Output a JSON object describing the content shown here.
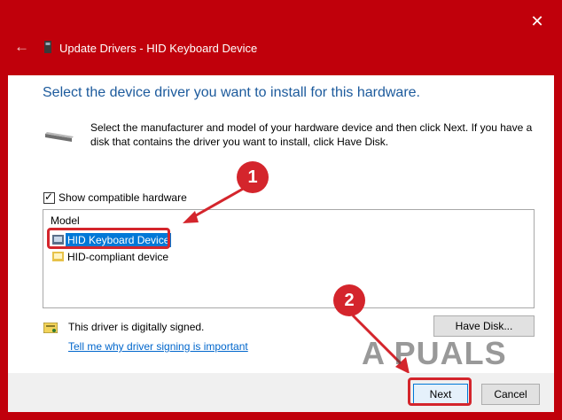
{
  "window": {
    "title": "Update Drivers - HID Keyboard Device",
    "close_icon": "close-icon",
    "back_icon": "back-arrow-icon",
    "accent_color": "#c0000b"
  },
  "main": {
    "heading": "Select the device driver you want to install for this hardware.",
    "description": "Select the manufacturer and model of your hardware device and then click Next. If you have a disk that contains the driver you want to install, click Have Disk.",
    "show_compatible": {
      "label": "Show compatible hardware",
      "checked": true
    }
  },
  "model_list": {
    "header": "Model",
    "items": [
      {
        "label": "HID Keyboard Device",
        "selected": true
      },
      {
        "label": "HID-compliant device",
        "selected": false
      }
    ]
  },
  "signing": {
    "status_text": "This driver is digitally signed.",
    "link_text": "Tell me why driver signing is important"
  },
  "buttons": {
    "have_disk": "Have Disk...",
    "next": "Next",
    "cancel": "Cancel"
  },
  "annotations": {
    "step_1": "1",
    "step_2": "2",
    "highlight_color": "#d4252c"
  },
  "watermark": "A  PUALS"
}
